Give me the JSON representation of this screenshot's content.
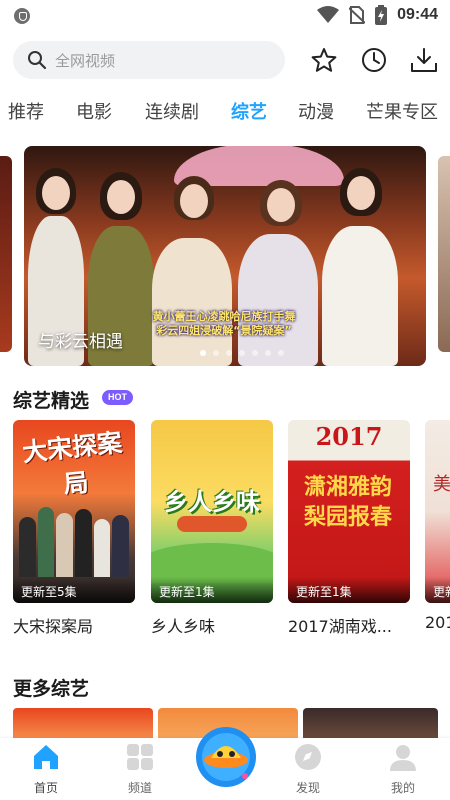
{
  "status_bar": {
    "time": "09:44",
    "icons": [
      "shield-icon",
      "wifi-icon",
      "no-sim-icon",
      "battery-charging-icon"
    ]
  },
  "search": {
    "placeholder": "全网视频",
    "icon": "search-icon"
  },
  "header_actions": [
    "star-icon",
    "history-clock-icon",
    "download-icon"
  ],
  "tabs": [
    {
      "label": "推荐",
      "active": false
    },
    {
      "label": "电影",
      "active": false
    },
    {
      "label": "连续剧",
      "active": false
    },
    {
      "label": "综艺",
      "active": true
    },
    {
      "label": "动漫",
      "active": false
    },
    {
      "label": "芒果专区",
      "active": false
    }
  ],
  "banner": {
    "title": "与彩云相遇",
    "caption_line1": "黄小蕾王心凌跳哈尼族打手舞",
    "caption_line2": "彩云四姐浸破解“景院疑案”",
    "dot_count": 7,
    "active_dot": 0
  },
  "section_variety": {
    "title": "综艺精选",
    "badge": "HOT",
    "items": [
      {
        "title": "大宋探案局",
        "update": "更新至5集",
        "poster_text": "大宋探案局"
      },
      {
        "title": "乡人乡味",
        "update": "更新至1集",
        "poster_text": "乡人乡味"
      },
      {
        "title": "2017湖南戏...",
        "update": "更新至1集",
        "poster_text": "2017",
        "poster_subtext": "潇湘雅韵 梨园报春"
      },
      {
        "title": "201",
        "update": "更新",
        "poster_text": "美"
      }
    ]
  },
  "section_more": {
    "title": "更多综艺"
  },
  "bottom_nav": [
    {
      "label": "首页",
      "icon": "home-icon",
      "active": true
    },
    {
      "label": "频道",
      "icon": "grid-icon",
      "active": false
    },
    {
      "label": "",
      "icon": "ufo-mascot-icon",
      "active": false
    },
    {
      "label": "发现",
      "icon": "compass-icon",
      "active": false
    },
    {
      "label": "我的",
      "icon": "user-icon",
      "active": false
    }
  ],
  "colors": {
    "accent": "#1fa3ff",
    "badge": "#7c5cff",
    "search_bg": "#f1f2f4"
  }
}
